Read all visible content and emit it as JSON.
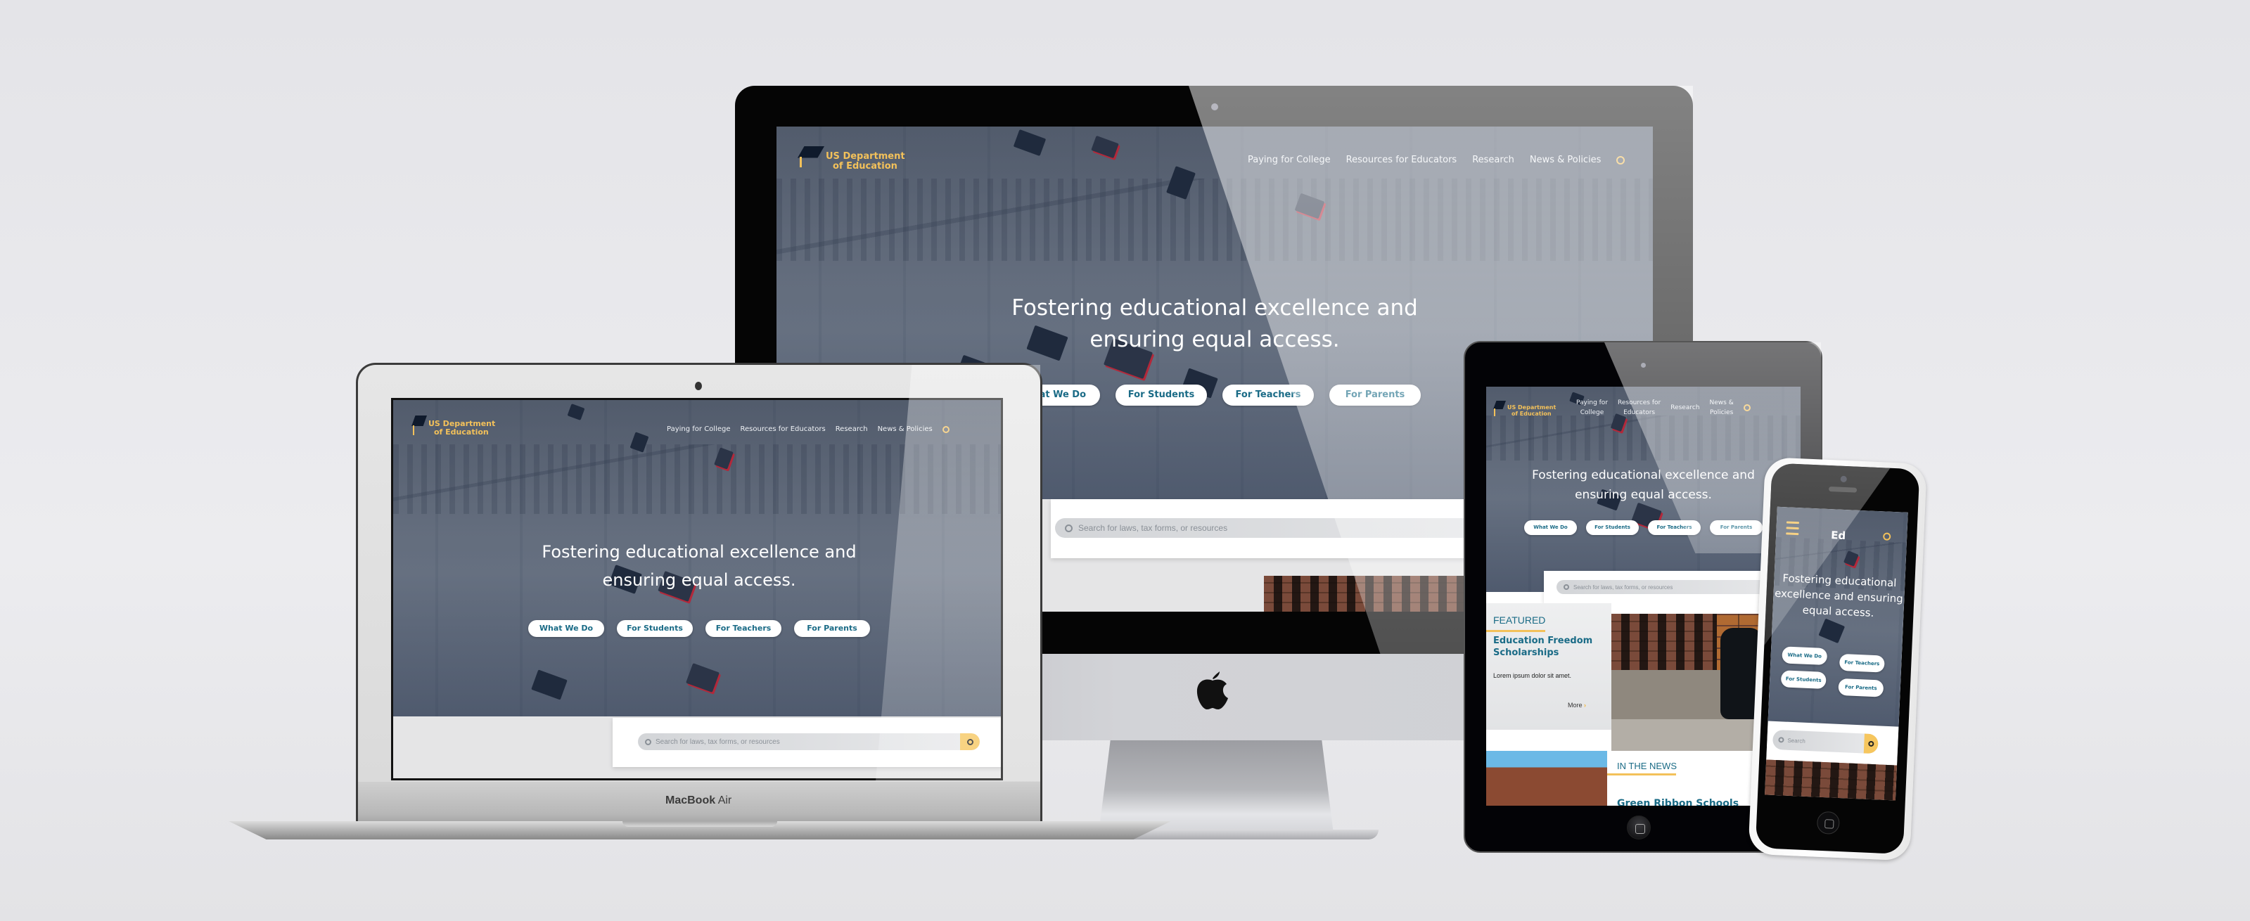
{
  "site": {
    "logo_line1": "US Department",
    "logo_line2": "of Education",
    "logo_short": "Ed",
    "nav": [
      {
        "label": "Paying for College",
        "label_wrapped": [
          "Paying for",
          "College"
        ]
      },
      {
        "label": "Resources for Educators",
        "label_wrapped": [
          "Resources for",
          "Educators"
        ]
      },
      {
        "label": "Research",
        "label_wrapped": [
          "Research"
        ]
      },
      {
        "label": "News & Policies",
        "label_wrapped": [
          "News &",
          "Policies"
        ]
      }
    ],
    "tagline_line1": "Fostering educational excellence and",
    "tagline_line2": "ensuring equal access.",
    "tagline_mobile": [
      "Fostering educational",
      "excellence and ensuring",
      "equal access."
    ],
    "cta_buttons": [
      "What We Do",
      "For Students",
      "For Teachers",
      "For Parents"
    ],
    "search_placeholder": "Search for laws, tax forms, or resources",
    "search_placeholder_mobile": "Search",
    "featured": {
      "label": "FEATURED",
      "title": "Education Freedom Scholarships",
      "body": "Lorem ipsum dolor sit amet.",
      "more": "More"
    },
    "news": {
      "label": "IN THE NEWS",
      "headline_partial": "Green Ribbon Schools"
    }
  },
  "devices": {
    "laptop_brand": "MacBook",
    "laptop_model": "Air"
  },
  "colors": {
    "accent_gold": "#f3c15a",
    "brand_teal": "#1a6b86",
    "hero_overlay": "#3c4a5e"
  },
  "icons": {
    "logo": "graduation-cap-icon",
    "search": "search-icon",
    "menu": "hamburger-menu-icon",
    "more": "chevron-right-icon",
    "apple": "apple-logo-icon",
    "home_button": "home-button-icon"
  }
}
